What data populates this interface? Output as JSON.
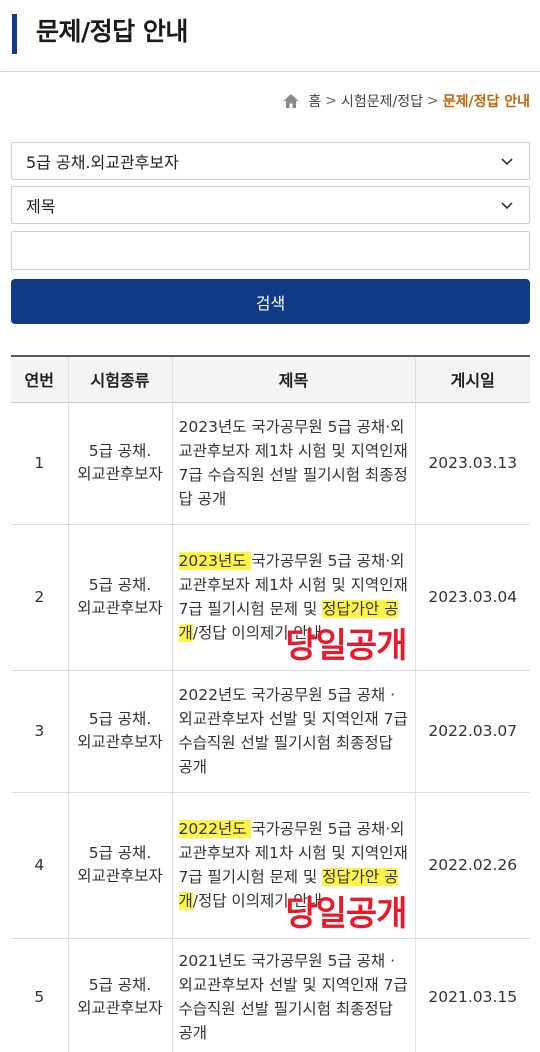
{
  "header": {
    "title": "문제/정답 안내"
  },
  "breadcrumb": {
    "home": "홈",
    "sep": ">",
    "level1": "시험문제/정답",
    "current": "문제/정답 안내"
  },
  "filters": {
    "exam_select": "5급 공채.외교관후보자",
    "field_select": "제목",
    "search_value": "",
    "search_label": "검색"
  },
  "table": {
    "headers": [
      "연번",
      "시험종류",
      "제목",
      "게시일"
    ],
    "rows": [
      {
        "no": "1",
        "type_l1": "5급 공채.",
        "type_l2": "외교관후보자",
        "title_pre": "2023년도 국가공무원 5급 공채·외교관후보자 제1차 시험 및 지역인재 7급 수습직원 선발 필기시험 최종정답 공개",
        "date": "2023.03.13"
      },
      {
        "no": "2",
        "type_l1": "5급 공채.",
        "type_l2": "외교관후보자",
        "title_hl1": "2023년도 ",
        "title_mid": "국가공무원 5급 공채·외교관후보자 제1차 시험 및 지역인재 7급 필기시험 문제 및 ",
        "title_hl2": "정답가안 공개",
        "title_post": "/정답 이의제기 안내",
        "stamp": "당일공개",
        "date": "2023.03.04"
      },
      {
        "no": "3",
        "type_l1": "5급 공채.",
        "type_l2": "외교관후보자",
        "title_pre": "2022년도 국가공무원 5급 공채 · 외교관후보자 선발 및 지역인재 7급 수습직원 선발 필기시험 최종정답 공개",
        "date": "2022.03.07"
      },
      {
        "no": "4",
        "type_l1": "5급 공채.",
        "type_l2": "외교관후보자",
        "title_hl1": "2022년도 ",
        "title_mid": "국가공무원 5급 공채·외교관후보자 제1차 시험 및 지역인재 7급 필기시험 문제 및 ",
        "title_hl2": "정답가안 공개",
        "title_post": "/정답 이의제기 안내",
        "stamp": "당일공개",
        "date": "2022.02.26"
      },
      {
        "no": "5",
        "type_l1": "5급 공채.",
        "type_l2": "외교관후보자",
        "title_pre": "2021년도 국가공무원 5급 공채 · 외교관후보자 선발 및 지역인재 7급 수습직원 선발 필기시험 최종정답 공개",
        "date": "2021.03.15"
      }
    ]
  },
  "colors": {
    "accent": "#0f3a86",
    "breadcrumb_current": "#c0650a",
    "highlight": "#fff54a",
    "stamp": "#e8192c"
  },
  "icons": {
    "home": "home-icon",
    "dropdown": "chevron-down-icon"
  }
}
